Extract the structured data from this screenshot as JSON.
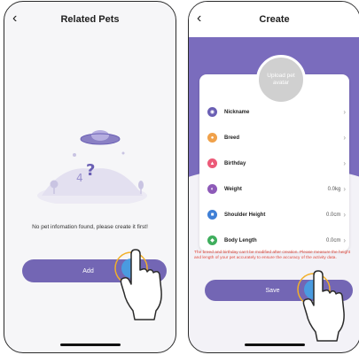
{
  "left": {
    "title": "Related Pets",
    "empty_message": "No pet infomation found, please create it first!",
    "add_label": "Add"
  },
  "right": {
    "title": "Create",
    "avatar_label": "Upload pet avatar",
    "fields": [
      {
        "label": "Nickname",
        "value": "",
        "icon": "nickname-icon",
        "color": "#6a5fb4"
      },
      {
        "label": "Breed",
        "value": "",
        "icon": "breed-icon",
        "color": "#f0a14a"
      },
      {
        "label": "Birthday",
        "value": "",
        "icon": "birthday-icon",
        "color": "#ec5a78"
      },
      {
        "label": "Weight",
        "value": "0.0kg",
        "icon": "weight-icon",
        "color": "#8d5ab8"
      },
      {
        "label": "Shoulder Height",
        "value": "0.0cm",
        "icon": "shoulder-height-icon",
        "color": "#3f7fd6"
      },
      {
        "label": "Body Length",
        "value": "0.0cm",
        "icon": "body-length-icon",
        "color": "#3fae5d"
      }
    ],
    "warning": "The breed and birthday can't be modified after creation. Please measure the height and length of your pet accurately to ensure the accuracy of the activity data.",
    "save_label": "Save"
  },
  "colors": {
    "accent": "#7366b4",
    "band": "#7a6cbd",
    "warning": "#e0483c"
  }
}
